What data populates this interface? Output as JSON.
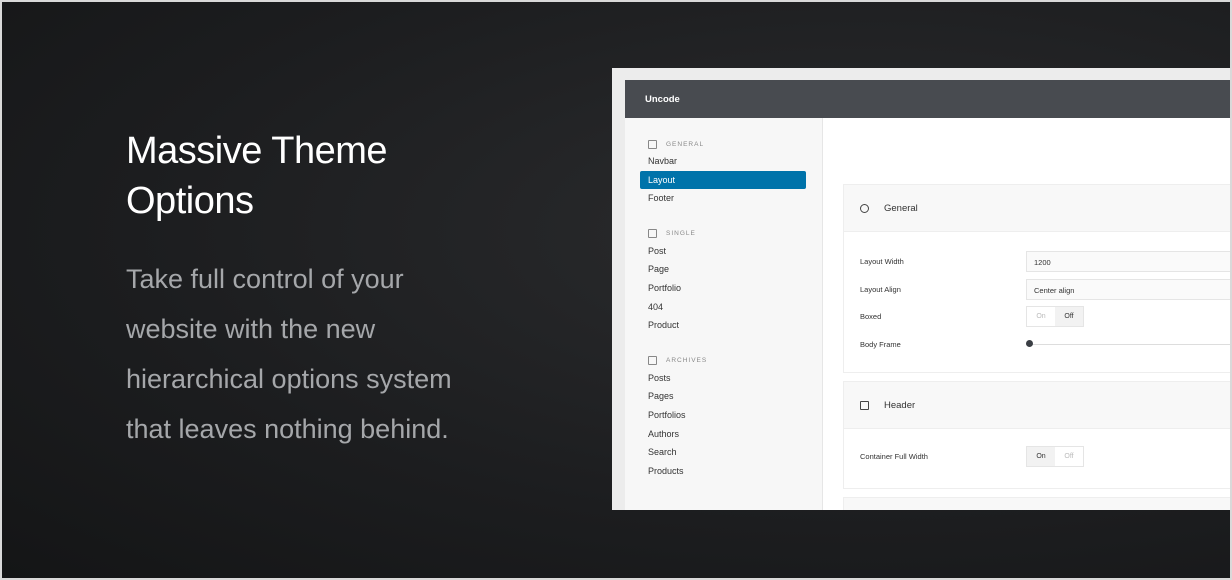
{
  "hero": {
    "title": "Massive Theme Options",
    "text": "Take full control of your website with the new hierarchical options system that leaves nothing behind."
  },
  "app": {
    "title": "Uncode"
  },
  "sidebar": {
    "groups": [
      {
        "label": "GENERAL",
        "icon": "layout-icon",
        "items": [
          "Navbar",
          "Layout",
          "Footer"
        ]
      },
      {
        "label": "SINGLE",
        "icon": "file-icon",
        "items": [
          "Post",
          "Page",
          "Portfolio",
          "404",
          "Product"
        ]
      },
      {
        "label": "ARCHIVES",
        "icon": "archive-icon",
        "items": [
          "Posts",
          "Pages",
          "Portfolios",
          "Authors",
          "Search",
          "Products"
        ]
      }
    ],
    "active": "Layout"
  },
  "panels": {
    "general": {
      "title": "General",
      "icon": "globe-icon",
      "layout_width_label": "Layout Width",
      "layout_width": "1200",
      "layout_align_label": "Layout Align",
      "layout_align": "Center align",
      "boxed_label": "Boxed",
      "on": "On",
      "off": "Off",
      "boxed": "Off",
      "body_frame_label": "Body Frame",
      "body_frame": 0
    },
    "header": {
      "title": "Header",
      "icon": "columns-icon",
      "container_label": "Container Full Width",
      "on": "On",
      "off": "Off",
      "container": "On"
    }
  },
  "colors": {
    "accent": "#0073aa",
    "topbar": "#484b50"
  }
}
